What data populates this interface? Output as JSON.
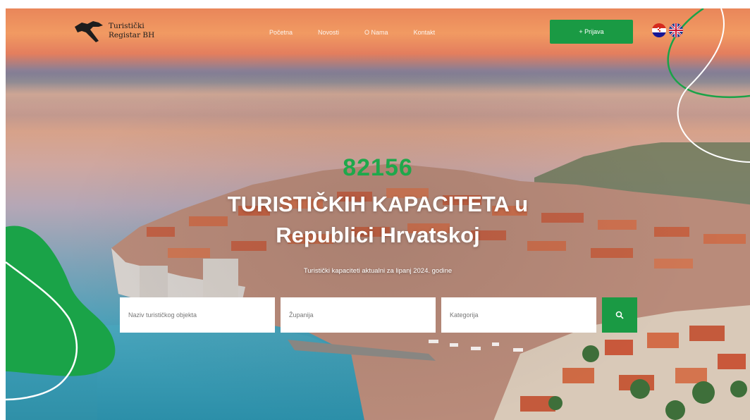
{
  "header": {
    "logo_line1": "Turistički",
    "logo_line2": "Registar BH",
    "nav": [
      "Početna",
      "Novosti",
      "O Nama",
      "Kontakt"
    ],
    "login_label": "+ Prijava",
    "languages": [
      "croatian-flag-icon",
      "english-flag-icon"
    ]
  },
  "hero": {
    "counter": "82156",
    "title_line1": "TURISTIČKIH KAPACITETA u",
    "title_line2": "Republici Hrvatskoj",
    "subtitle": "Turistički kapaciteti aktualni za lipanj 2024. godine"
  },
  "search": {
    "name_placeholder": "Naziv turističkog objekta",
    "county_placeholder": "Županija",
    "category_placeholder": "Kategorija",
    "button_icon": "search-icon"
  },
  "colors": {
    "accent": "#1a9a44",
    "counter": "#1fa84b"
  }
}
